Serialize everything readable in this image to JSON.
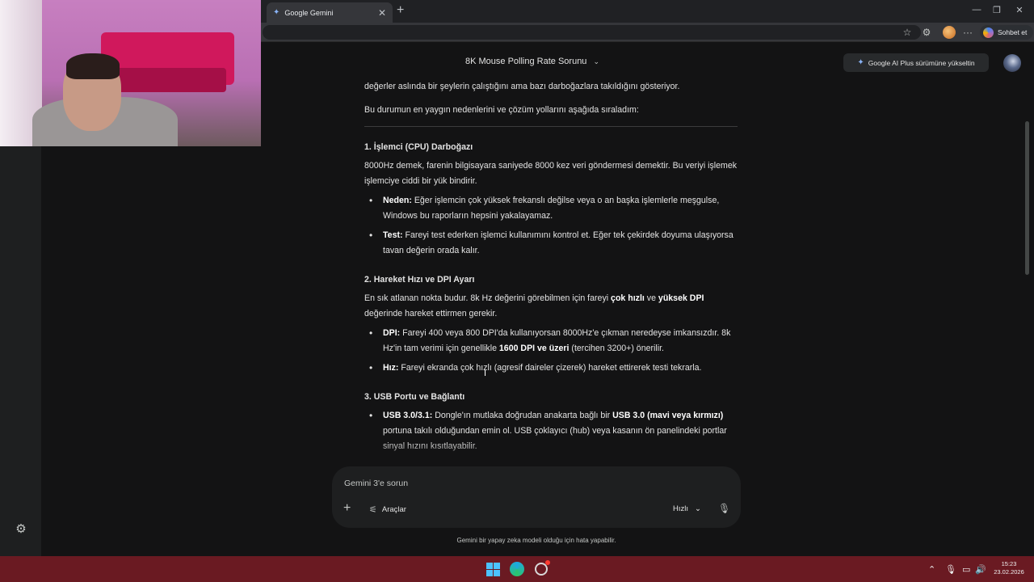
{
  "browser": {
    "tab_title": "Google Gemini",
    "tab_close": "✕",
    "new_tab": "+",
    "minimize": "—",
    "restore": "❐",
    "close": "✕",
    "star_icon": "☆",
    "extensions_icon": "⚙",
    "menu_icon": "···",
    "sohbet_label": "Sohbet et"
  },
  "header": {
    "conversation_title": "8K Mouse Polling Rate Sorunu",
    "upgrade_label": "Google AI Plus sürümüne yükseltin"
  },
  "response": {
    "intro_line1": "değerler aslında bir şeylerin çalıştığını ama bazı darboğazlara takıldığını gösteriyor.",
    "intro_line2": "Bu durumun en yaygın nedenlerini ve çözüm yollarını aşağıda sıraladım:",
    "sections": [
      {
        "title": "1. İşlemci (CPU) Darboğazı",
        "text": "8000Hz demek, farenin bilgisayara saniyede 8000 kez veri göndermesi demektir. Bu veriyi işlemek işlemciye ciddi bir yük bindirir.",
        "bullets": [
          {
            "label": "Neden:",
            "text": " Eğer işlemcin çok yüksek frekanslı değilse veya o an başka işlemlerle meşgulse, Windows bu raporların hepsini yakalayamaz."
          },
          {
            "label": "Test:",
            "text": " Fareyi test ederken işlemci kullanımını kontrol et. Eğer tek çekirdek doyuma ulaşıyorsa tavan değerin orada kalır."
          }
        ]
      },
      {
        "title": "2. Hareket Hızı ve DPI Ayarı",
        "text_a": "En sık atlanan nokta budur. 8k Hz değerini görebilmen için fareyi ",
        "bold_a": "çok hızlı",
        "text_b": " ve ",
        "bold_b": "yüksek DPI",
        "text_c": " değerinde hareket ettirmen gerekir.",
        "bullets": [
          {
            "label": "DPI:",
            "text_a": " Fareyi 400 veya 800 DPI'da kullanıyorsan 8000Hz'e çıkman neredeyse imkansızdır. 8k Hz'in tam verimi için genellikle ",
            "bold": "1600 DPI ve üzeri",
            "text_b": " (tercihen 3200+) önerilir."
          },
          {
            "label": "Hız:",
            "text": " Fareyi ekranda çok hızlı (agresif daireler çizerek) hareket ettirerek testi tekrarla."
          }
        ]
      },
      {
        "title": "3. USB Portu ve Bağlantı",
        "bullets": [
          {
            "label": "USB 3.0/3.1:",
            "text_a": " Dongle'ın mutlaka doğrudan anakarta bağlı bir ",
            "bold": "USB 3.0 (mavi veya kırmızı)",
            "text_b": " portuna takılı olduğundan emin ol. USB çoklayıcı (hub) veya kasanın ön panelindeki portlar sinyal hızını kısıtlayabilir."
          }
        ]
      }
    ]
  },
  "prompt": {
    "placeholder": "Gemini 3'e sorun",
    "tools_label": "Araçlar",
    "model_label": "Hızlı",
    "disclaimer": "Gemini bir yapay zeka modeli olduğu için hata yapabilir."
  },
  "taskbar": {
    "time": "15:23",
    "date": "23.02.2026"
  },
  "icons": {
    "plus": "+",
    "tools": "⚟",
    "chevron": "⌄",
    "mic": "🎙",
    "settings": "⚙",
    "spark": "✦",
    "tray_up": "⌃",
    "tray_mic": "🎙",
    "tray_net": "▭",
    "tray_vol": "🔊"
  }
}
